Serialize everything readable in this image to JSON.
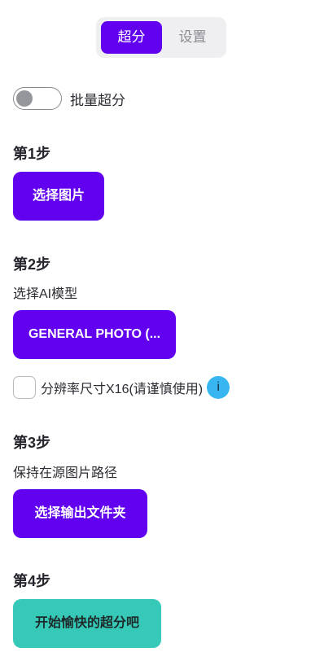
{
  "tabs": [
    {
      "label": "超分",
      "active": true
    },
    {
      "label": "设置",
      "active": false
    }
  ],
  "batch": {
    "label": "批量超分",
    "enabled": false
  },
  "step1": {
    "title": "第1步",
    "button": "选择图片"
  },
  "step2": {
    "title": "第2步",
    "desc": "选择AI模型",
    "button": "GENERAL PHOTO (...",
    "checkbox_label": "分辨率尺寸X16(请谨慎使用)",
    "checkbox_checked": false,
    "info_icon": "i"
  },
  "step3": {
    "title": "第3步",
    "desc": "保持在源图片路径",
    "button": "选择输出文件夹"
  },
  "step4": {
    "title": "第4步",
    "button": "开始愉快的超分吧"
  },
  "colors": {
    "accent": "#6200f0",
    "start_button": "#36c9b8",
    "info": "#38b6f2"
  }
}
